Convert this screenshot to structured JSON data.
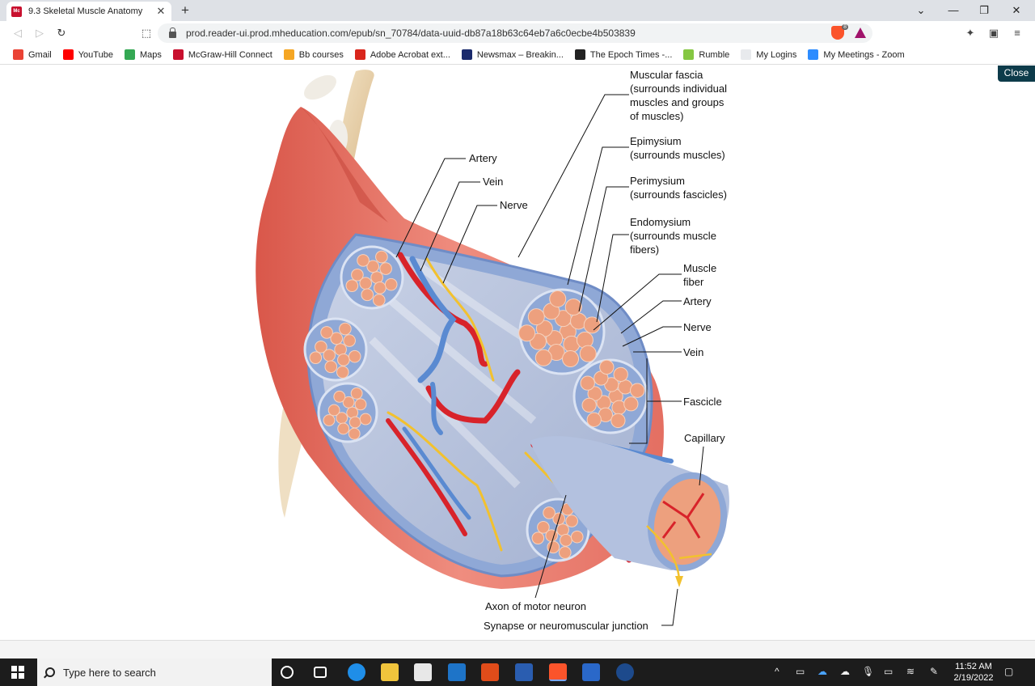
{
  "browser": {
    "tab_title": "9.3 Skeletal Muscle Anatomy",
    "url": "prod.reader-ui.prod.mheducation.com/epub/sn_70784/data-uuid-db87a18b63c64eb7a6c0ecbe4b503839",
    "shields_count": "8",
    "bookmarks": [
      {
        "label": "Gmail",
        "icon": "gmail-icon",
        "color": "#ea4335"
      },
      {
        "label": "YouTube",
        "icon": "youtube-icon",
        "color": "#ff0000"
      },
      {
        "label": "Maps",
        "icon": "maps-icon",
        "color": "#34a853"
      },
      {
        "label": "McGraw-Hill Connect",
        "icon": "mcgraw-hill-icon",
        "color": "#c8102e"
      },
      {
        "label": "Bb courses",
        "icon": "blackboard-icon",
        "color": "#f5a623"
      },
      {
        "label": "Adobe Acrobat ext...",
        "icon": "adobe-acrobat-icon",
        "color": "#d9261c"
      },
      {
        "label": "Newsmax – Breakin...",
        "icon": "newsmax-icon",
        "color": "#1a2a6c"
      },
      {
        "label": "The Epoch Times -...",
        "icon": "epoch-times-icon",
        "color": "#222222"
      },
      {
        "label": "Rumble",
        "icon": "rumble-icon",
        "color": "#85c742"
      },
      {
        "label": "My Logins",
        "icon": "logins-icon",
        "color": "#e8eaed"
      },
      {
        "label": "My Meetings - Zoom",
        "icon": "zoom-icon",
        "color": "#2d8cff"
      }
    ]
  },
  "viewer": {
    "close_label": "Close"
  },
  "diagram": {
    "labels": {
      "muscular_fascia": [
        "Muscular fascia",
        "(surrounds individual",
        "muscles and groups",
        "of muscles)"
      ],
      "epimysium": [
        "Epimysium",
        "(surrounds muscles)"
      ],
      "perimysium": [
        "Perimysium",
        "(surrounds fascicles)"
      ],
      "endomysium": [
        "Endomysium",
        "(surrounds muscle",
        "fibers)"
      ],
      "muscle_fiber": [
        "Muscle",
        "fiber"
      ],
      "artery_right": "Artery",
      "nerve_right": "Nerve",
      "vein_right": "Vein",
      "fascicle": "Fascicle",
      "capillary": "Capillary",
      "artery_left": "Artery",
      "vein_left": "Vein",
      "nerve_left": "Nerve",
      "axon": "Axon of motor neuron",
      "synapse": "Synapse or neuromuscular junction"
    }
  },
  "taskbar": {
    "search_placeholder": "Type here to search",
    "time": "11:52 AM",
    "date": "2/19/2022"
  }
}
